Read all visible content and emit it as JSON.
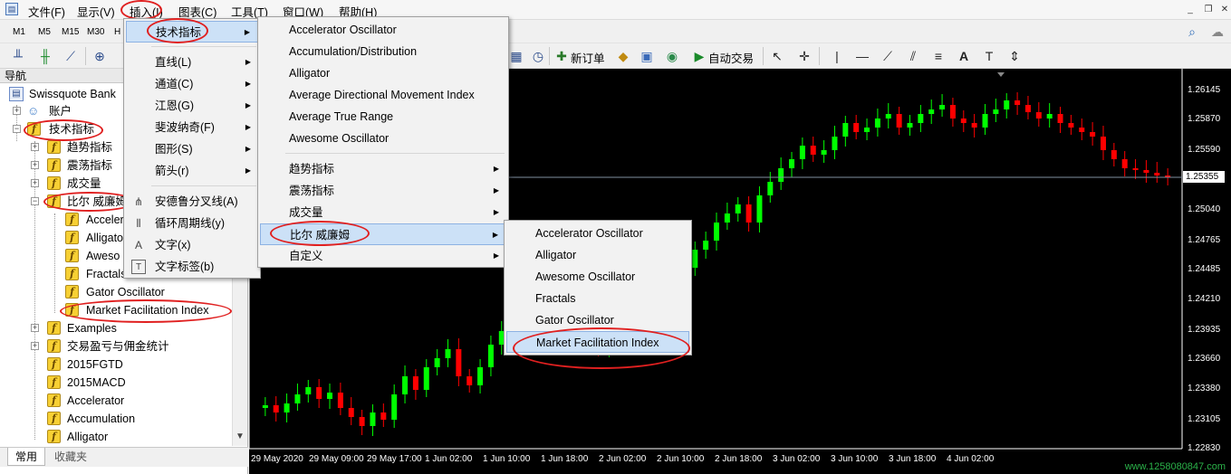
{
  "menubar": {
    "items": [
      "文件(F)",
      "显示(V)",
      "插入(I)",
      "图表(C)",
      "工具(T)",
      "窗口(W)",
      "帮助(H)"
    ]
  },
  "toolbar1": {
    "timeframes": [
      "M1",
      "M5",
      "M15",
      "M30",
      "H"
    ]
  },
  "toolbar2": {
    "new_order": "新订单",
    "auto_trade": "自动交易"
  },
  "navigator": {
    "title": "导航",
    "root": "Swissquote Bank",
    "items": [
      {
        "label": "账户",
        "level": 1
      },
      {
        "label": "技术指标",
        "level": 1
      },
      {
        "label": "趋势指标",
        "level": 2
      },
      {
        "label": "震荡指标",
        "level": 2
      },
      {
        "label": "成交量",
        "level": 2
      },
      {
        "label": "比尔 威廉姆",
        "level": 2
      },
      {
        "label": "Acceler",
        "level": 3
      },
      {
        "label": "Alligato",
        "level": 3
      },
      {
        "label": "Aweso",
        "level": 3
      },
      {
        "label": "Fractals",
        "level": 3
      },
      {
        "label": "Gator Oscillator",
        "level": 3
      },
      {
        "label": "Market Facilitation Index",
        "level": 3
      },
      {
        "label": "Examples",
        "level": 2
      },
      {
        "label": "交易盈亏与佣金统计",
        "level": 2
      },
      {
        "label": "2015FGTD",
        "level": 2
      },
      {
        "label": "2015MACD",
        "level": 2
      },
      {
        "label": "Accelerator",
        "level": 2
      },
      {
        "label": "Accumulation",
        "level": 2
      },
      {
        "label": "Alligator",
        "level": 2
      }
    ],
    "tabs": [
      "常用",
      "收藏夹"
    ]
  },
  "insert_menu": {
    "items": [
      "技术指标",
      "直线(L)",
      "通道(C)",
      "江恩(G)",
      "斐波纳奇(F)",
      "图形(S)",
      "箭头(r)",
      "安德鲁分叉线(A)",
      "循环周期线(y)",
      "文字(x)",
      "文字标签(b)"
    ]
  },
  "indicators_menu": {
    "items": [
      "Accelerator Oscillator",
      "Accumulation/Distribution",
      "Alligator",
      "Average Directional Movement Index",
      "Average True Range",
      "Awesome Oscillator"
    ],
    "submenus": [
      "趋势指标",
      "震荡指标",
      "成交量",
      "比尔 威廉姆",
      "自定义"
    ]
  },
  "bill_williams_menu": {
    "items": [
      "Accelerator Oscillator",
      "Alligator",
      "Awesome Oscillator",
      "Fractals",
      "Gator Oscillator",
      "Market Facilitation Index"
    ]
  },
  "chart": {
    "current_price": "1.25355",
    "y_ticks": [
      "1.26145",
      "1.25870",
      "1.25590",
      "1.25355",
      "1.25040",
      "1.24765",
      "1.24485",
      "1.24210",
      "1.23935",
      "1.23660",
      "1.23380",
      "1.23105",
      "1.22830"
    ],
    "x_ticks": [
      "29 May 2020",
      "29 May 09:00",
      "29 May 17:00",
      "1 Jun 02:00",
      "1 Jun 10:00",
      "1 Jun 18:00",
      "2 Jun 02:00",
      "2 Jun 10:00",
      "2 Jun 18:00",
      "3 Jun 02:00",
      "3 Jun 10:00",
      "3 Jun 18:00",
      "4 Jun 02:00"
    ],
    "colors": {
      "up": "#00ff00",
      "down": "#ff0000",
      "background": "#000000"
    }
  },
  "watermark": "www.1258080847.com"
}
